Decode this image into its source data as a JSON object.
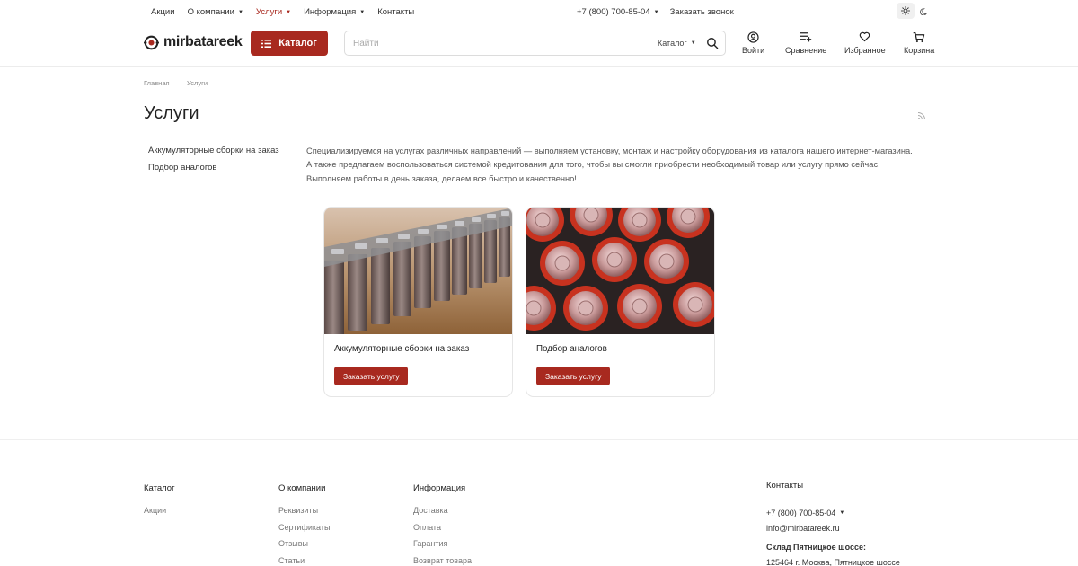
{
  "topbar": {
    "nav": [
      {
        "label": "Акции",
        "dropdown": false,
        "active": false
      },
      {
        "label": "О компании",
        "dropdown": true,
        "active": false
      },
      {
        "label": "Услуги",
        "dropdown": true,
        "active": true
      },
      {
        "label": "Информация",
        "dropdown": true,
        "active": false
      },
      {
        "label": "Контакты",
        "dropdown": false,
        "active": false
      }
    ],
    "phone": "+7 (800) 700-85-04",
    "callback": "Заказать звонок"
  },
  "header": {
    "logo": "mirbatareek",
    "catalog_button": "Каталог",
    "search_placeholder": "Найти",
    "search_scope": "Каталог",
    "icons": {
      "login": "Войти",
      "compare": "Сравнение",
      "favorites": "Избранное",
      "cart": "Корзина"
    }
  },
  "breadcrumb": {
    "home": "Главная",
    "separator": "—",
    "current": "Услуги"
  },
  "page": {
    "title": "Услуги",
    "side_menu": [
      "Аккумуляторные сборки на заказ",
      "Подбор аналогов"
    ],
    "description": [
      "Специализируемся на услугах различных направлений — выполняем установку, монтаж и настройку оборудования из каталога нашего интернет-магазина.",
      "А также предлагаем воспользоваться системой кредитования для того, чтобы вы смогли приобрести необходимый товар или услугу прямо сейчас.",
      "Выполняем работы в день заказа, делаем все быстро и качественно!"
    ],
    "cards": [
      {
        "title": "Аккумуляторные сборки на заказ",
        "button": "Заказать услугу"
      },
      {
        "title": "Подбор аналогов",
        "button": "Заказать услугу"
      }
    ]
  },
  "footer": {
    "catalog": {
      "heading": "Каталог",
      "links": [
        "Акции"
      ]
    },
    "company": {
      "heading": "О компании",
      "links": [
        "Реквизиты",
        "Сертификаты",
        "Отзывы",
        "Статьи"
      ]
    },
    "info": {
      "heading": "Информация",
      "links": [
        "Доставка",
        "Оплата",
        "Гарантия",
        "Возврат товара"
      ]
    },
    "contacts": {
      "heading": "Контакты",
      "phone": "+7 (800) 700-85-04",
      "email": "info@mirbatareek.ru",
      "warehouse": "Склад Пятницкое шоссе:",
      "address": "125464 г. Москва, Пятницкое шоссе"
    }
  },
  "colors": {
    "accent": "#a8291f"
  }
}
